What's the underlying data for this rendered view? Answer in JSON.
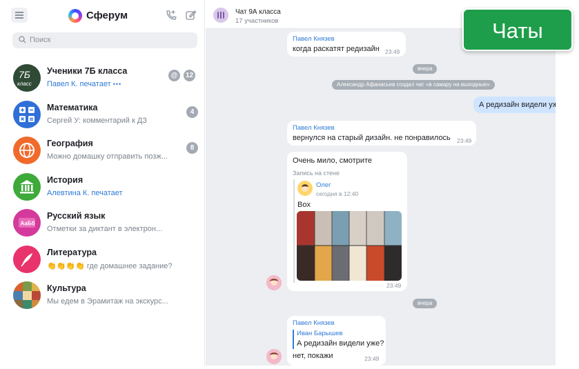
{
  "sidebar": {
    "brand": "Сферум",
    "search_placeholder": "Поиск",
    "chats": [
      {
        "title": "Ученики 7Б класса",
        "subtitle": "Павел К. печатает",
        "mention": "@",
        "badge": "12",
        "avatar_text": "7Б класс"
      },
      {
        "title": "Математика",
        "subtitle": "Сергей У: комментарий к ДЗ",
        "badge": "4"
      },
      {
        "title": "География",
        "subtitle": "Можно домашку отправить позж...",
        "badge": "8"
      },
      {
        "title": "История",
        "subtitle": "Алевтина К. печатает"
      },
      {
        "title": "Русский язык",
        "subtitle": "Отметки за диктант в электрон...",
        "avatar_text": "АаБб"
      },
      {
        "title": "Литература",
        "subtitle": "👏👏👏👏 где домашнее задание?"
      },
      {
        "title": "Культура",
        "subtitle": "Мы едем в Эрамитаж на экскурс..."
      }
    ]
  },
  "chat": {
    "title": "Чат 9А класса",
    "members": "17 участников",
    "messages": [
      {
        "sender": "Павел Князев",
        "text": "когда раскатят редизайн",
        "time": "23:49"
      },
      {
        "pill": "вчера"
      },
      {
        "system": "Александр Афанасьев создал чат «в самару на выходные»"
      },
      {
        "outgoing": "А редизайн видели уже?"
      },
      {
        "sender": "Павел Князев",
        "text": "вернулся на старый дизайн. не понравилось",
        "time": "23:49"
      },
      {
        "text": "Очень мило, смотрите",
        "repost_label": "Запись на стене",
        "repost_author": "Олег",
        "repost_time": "сегодня в 12:40",
        "repost_text": "Box",
        "time": "23:49"
      },
      {
        "pill": "вчера"
      },
      {
        "sender": "Павел Князев",
        "reply_author": "Иван Барышев",
        "reply_text": "А редизайн видели уже?",
        "text": "нет, покажи",
        "time": "23:49"
      }
    ]
  },
  "overlay_label": "Чаты",
  "colors": {
    "accent": "#2f7ad6",
    "tag": "#1e9e4b",
    "badge": "#a3aab3"
  }
}
